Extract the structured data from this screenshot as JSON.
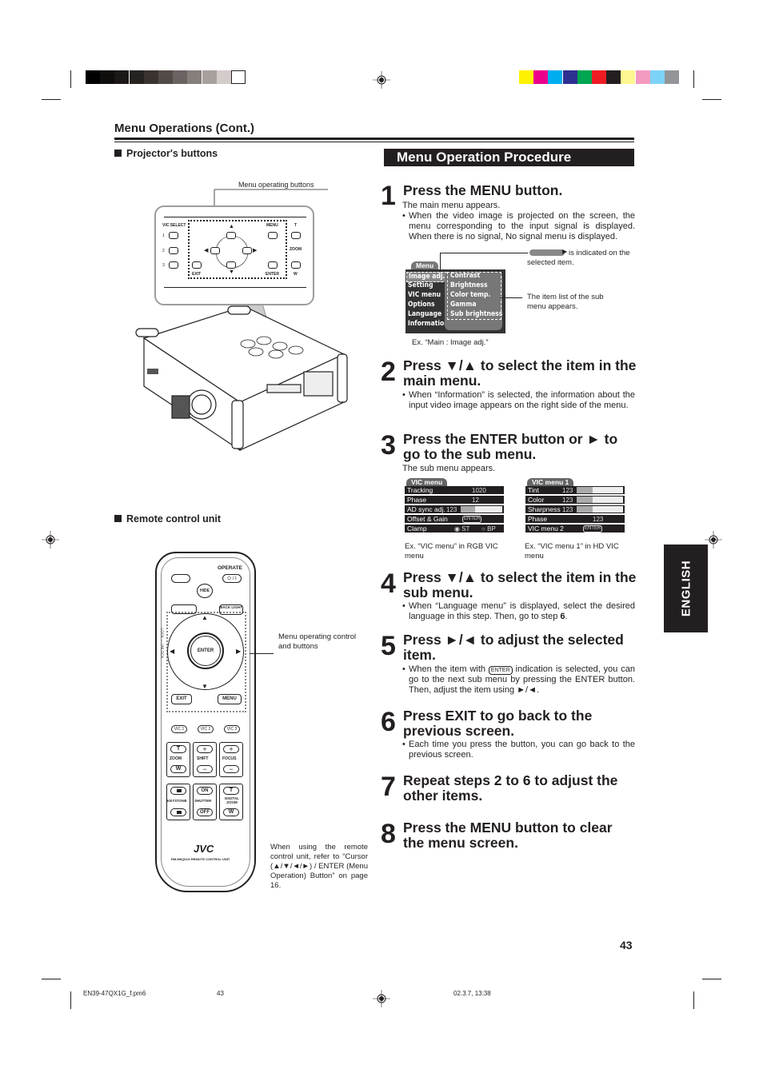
{
  "color_bars": {
    "grays": [
      "#000000",
      "#0f0e0d",
      "#1b1817",
      "#26221f",
      "#3a3330",
      "#534b47",
      "#6b6361",
      "#857e7b",
      "#a8a09d",
      "#d4cccb",
      "#ffffff"
    ],
    "colors": [
      "#fff200",
      "#ec008c",
      "#00aeef",
      "#2e3192",
      "#00a651",
      "#ed1c24",
      "#231f20",
      "#fff78f",
      "#f49ac1",
      "#7dd3f7",
      "#939598"
    ]
  },
  "header": {
    "section_title": "Menu Operations (Cont.)"
  },
  "left": {
    "projector_heading": "Projector's buttons",
    "menu_buttons_callout": "Menu operating buttons",
    "panel": {
      "vic_select": "VIC SELECT",
      "nums": [
        "1",
        "2",
        "3"
      ],
      "menu": "MENU",
      "exit": "EXIT",
      "enter": "ENTER",
      "t": "T",
      "zoom": "ZOOM",
      "w": "W"
    },
    "remote_heading": "Remote control unit",
    "remote": {
      "operate": "OPERATE",
      "power": "⏻ / I",
      "hide": "HIDE",
      "back_light": "BACK LIGHT",
      "enter": "ENTER",
      "exit": "EXIT",
      "menu": "MENU",
      "vic1": "VIC 1",
      "vic2": "VIC 2",
      "vic3": "VIC 3",
      "zoom": "ZOOM",
      "shift": "SHIFT",
      "focus": "FOCUS",
      "keystone": "KEYSTONE",
      "shutter": "SHUTTER",
      "digital_zoom": "DIGITAL ZOOM",
      "t": "T",
      "w": "W",
      "plus": "+",
      "minus": "−",
      "on": "ON",
      "off": "OFF",
      "brand": "JVC",
      "model": "RM-M6Q61G REMOTE CONTROL UNIT",
      "lock": "LOCK ↔ UNLOCK"
    },
    "remote_callout": "Menu operating control and buttons",
    "remote_note": "When using the remote control unit, refer to “Cursor (▲/▼/◄/►) / ENTER (Menu Operation) Button” on page 16."
  },
  "procedure": {
    "banner": "Menu Operation Procedure",
    "steps": [
      {
        "num": "1",
        "title": "Press the MENU button.",
        "intro": "The main menu appears.",
        "bullet": "When the video image is projected on the screen, the menu corresponding to the input signal is displayed. When there is no signal, No signal menu is displayed."
      },
      {
        "num": "2",
        "title": "Press ▼/▲ to select the item in the main menu.",
        "bullet": "When “Information” is selected, the information about the input video image appears on the right side of the menu."
      },
      {
        "num": "3",
        "title": "Press the ENTER button or ► to go to the sub menu.",
        "intro": "The sub menu appears."
      },
      {
        "num": "4",
        "title": "Press ▼/▲ to select the item in the sub menu.",
        "bullet_pre": "When “Language menu” is displayed, select the desired language in this step. Then, go to step ",
        "bullet_bold": "6",
        "bullet_post": "."
      },
      {
        "num": "5",
        "title": "Press ►/◄ to adjust the selected item.",
        "bullet_pre": "When the item with ",
        "bullet_tag": "ENTER",
        "bullet_post": " indication is selected, you can go to the next sub menu by pressing the ENTER button. Then, adjust the item using ►/◄."
      },
      {
        "num": "6",
        "title": "Press EXIT to go back to the previous screen.",
        "bullet": "Each time you press the button, you can go back to the previous screen."
      },
      {
        "num": "7",
        "title": "Repeat steps 2 to 6 to adjust the other items."
      },
      {
        "num": "8",
        "title": "Press the MENU button to clear the menu screen."
      }
    ],
    "main_menu_example": {
      "tab": "Menu",
      "items": [
        "Image adj.",
        "Setting",
        "VIC menu",
        "Options",
        "Language",
        "Information"
      ],
      "selected": "Image adj.",
      "sub_items": [
        "Contrast",
        "Brightness",
        "Color temp.",
        "Gamma",
        "Sub brightness"
      ],
      "note_selected": "is indicated on the selected item.",
      "note_sublist": "The item list of the sub menu appears.",
      "caption": "Ex. “Main : Image adj.”"
    },
    "rgb_vic_menu": {
      "tab": "VIC menu",
      "rows": [
        {
          "label": "Tracking",
          "value": "1020"
        },
        {
          "label": "Phase",
          "value": "12"
        },
        {
          "label": "AD sync adj.",
          "value": "123",
          "bar": 0.35
        },
        {
          "label": "Offset & Gain",
          "value": "ENTER"
        },
        {
          "label": "Clamp",
          "opt1": "ST",
          "opt2": "BP"
        }
      ],
      "caption": "Ex. “VIC menu” in RGB VIC menu"
    },
    "hd_vic_menu": {
      "tab": "VIC menu 1",
      "rows": [
        {
          "label": "Tint",
          "value": "123",
          "bar": 0.35
        },
        {
          "label": "Color",
          "value": "123",
          "bar": 0.35
        },
        {
          "label": "Sharpness",
          "value": "123",
          "bar": 0.35
        },
        {
          "label": "Phase",
          "value": "123"
        },
        {
          "label": "VIC menu 2",
          "value": "ENTER"
        }
      ],
      "caption": "Ex. “VIC menu 1” in HD VIC menu"
    }
  },
  "side_tab": "ENGLISH",
  "page_number": "43",
  "footer": {
    "file": "EN39-47QX1G_f.pm6",
    "page": "43",
    "datetime": "02.3.7, 13:38"
  }
}
